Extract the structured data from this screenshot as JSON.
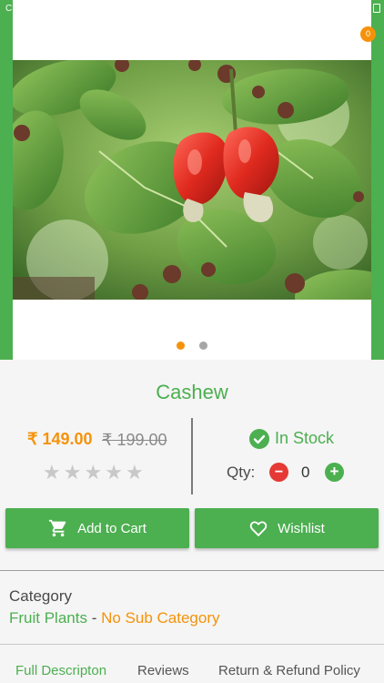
{
  "status": {
    "left": "C"
  },
  "header": {
    "cart_count": "0"
  },
  "carousel": {
    "slides": 2,
    "active_index": 0
  },
  "product": {
    "name": "Cashew",
    "price": "₹ 149.00",
    "old_price": "₹ 199.00",
    "rating": 0,
    "rating_max": 5,
    "stock_status": "In Stock",
    "qty_label": "Qty:",
    "qty_value": "0"
  },
  "actions": {
    "add_to_cart": "Add to Cart",
    "wishlist": "Wishlist"
  },
  "category": {
    "label": "Category",
    "main": "Fruit Plants",
    "separator": " - ",
    "sub": "No Sub Category"
  },
  "tabs": [
    {
      "label": "Full Descripton",
      "active": true
    },
    {
      "label": "Reviews",
      "active": false
    },
    {
      "label": "Return & Refund Policy",
      "active": false
    }
  ],
  "colors": {
    "brand_green": "#4caf50",
    "accent_orange": "#f5920a",
    "minus_red": "#e53935"
  }
}
